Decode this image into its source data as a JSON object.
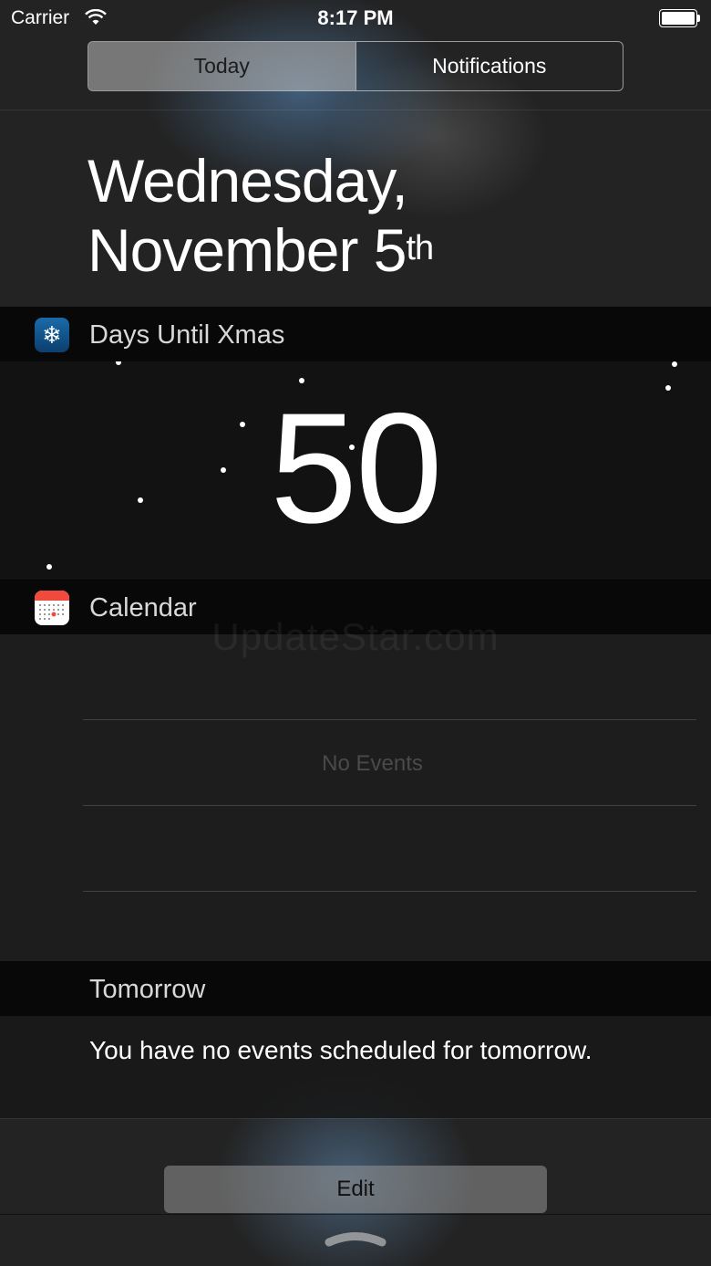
{
  "status_bar": {
    "carrier": "Carrier",
    "time": "8:17 PM"
  },
  "segmented_control": {
    "today": "Today",
    "notifications": "Notifications",
    "selected": "Today"
  },
  "date_header": {
    "weekday_line": "Wednesday,",
    "date_line": "November 5",
    "ordinal_suffix": "th"
  },
  "widgets": {
    "days_until_xmas": {
      "title": "Days Until Xmas",
      "icon": "snowflake-icon",
      "icon_color": "#1a6aa8",
      "days": "50"
    },
    "calendar": {
      "title": "Calendar",
      "icon": "calendar-icon",
      "empty_text": "No Events"
    },
    "tomorrow": {
      "title": "Tomorrow",
      "text": "You have no events scheduled for tomorrow."
    }
  },
  "watermark": "UpdateStar.com",
  "footer": {
    "edit_label": "Edit",
    "grabber_icon": "chevron-grabber-icon"
  }
}
